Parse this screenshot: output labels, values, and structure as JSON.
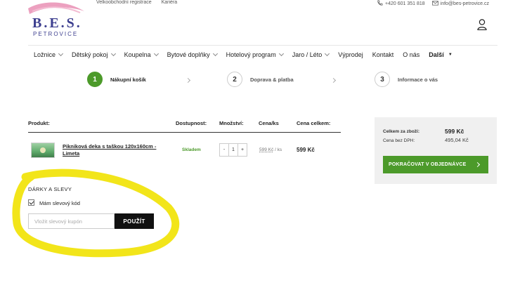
{
  "header": {
    "logo_text": "B.E.S.",
    "logo_sub": "PETROVICE",
    "top_links": [
      "Velkoobchodní registrace",
      "Kariéra"
    ],
    "phone": "+420 601 351 818",
    "email": "info@bes-petrovice.cz"
  },
  "nav": {
    "items": [
      "Ložnice",
      "Dětský pokoj",
      "Koupelna",
      "Bytové doplňky",
      "Hotelový program",
      "Jaro / Léto",
      "Výprodej",
      "Kontakt",
      "O nás",
      "Další"
    ]
  },
  "steps": [
    {
      "num": "1",
      "label": "Nákupní košík"
    },
    {
      "num": "2",
      "label": "Doprava & platba"
    },
    {
      "num": "3",
      "label": "Informace o vás"
    }
  ],
  "table": {
    "headers": [
      "Produkt:",
      "Dostupnost:",
      "Množství:",
      "Cena/ks",
      "Cena celkem:"
    ],
    "row": {
      "name": "Pikniková deka s taškou 120x160cm - Limeta",
      "stock": "Skladem",
      "qty_minus": "-",
      "qty": "1",
      "qty_plus": "+",
      "unit_price": "599 Kč",
      "unit_suffix": "/ ks",
      "total": "599 Kč"
    }
  },
  "summary": {
    "total_label": "Celkem za zboží:",
    "total_value": "599 Kč",
    "net_label": "Cena bez DPH:",
    "net_value": "495,04 Kč",
    "cta": "POKRAČOVAT V OBJEDNÁVCE"
  },
  "discount": {
    "title": "DÁRKY A SLEVY",
    "checkbox_label": "Mám slevový kód",
    "coupon_placeholder": "Vložit slevový kupón",
    "apply_label": "POUŽÍT"
  },
  "colors": {
    "accent": "#4c9a2a",
    "brand": "#3d3f8f",
    "highlight": "#f2e51a"
  }
}
